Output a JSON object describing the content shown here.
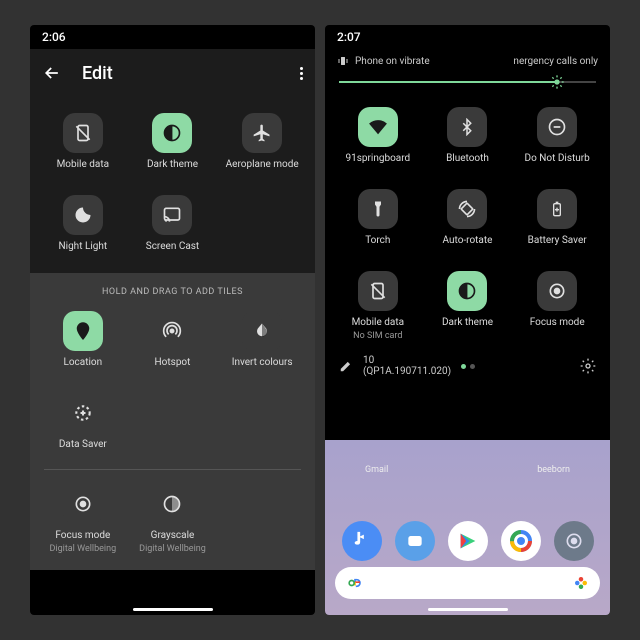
{
  "left": {
    "time": "2:06",
    "edit_title": "Edit",
    "tiles_active": [
      {
        "id": "mobile-data",
        "label": "Mobile data",
        "on": false
      },
      {
        "id": "dark-theme",
        "label": "Dark theme",
        "on": true
      },
      {
        "id": "aeroplane",
        "label": "Aeroplane mode",
        "on": false
      },
      {
        "id": "night-light",
        "label": "Night Light",
        "on": false
      },
      {
        "id": "screen-cast",
        "label": "Screen Cast",
        "on": false
      }
    ],
    "drag_hint": "HOLD AND DRAG TO ADD TILES",
    "tiles_available": [
      {
        "id": "location",
        "label": "Location",
        "on": true
      },
      {
        "id": "hotspot",
        "label": "Hotspot",
        "on": false
      },
      {
        "id": "invert",
        "label": "Invert colours",
        "on": false
      },
      {
        "id": "data-saver",
        "label": "Data Saver",
        "on": false
      }
    ],
    "tiles_wellbeing": [
      {
        "id": "focus-mode",
        "label": "Focus mode",
        "sub": "Digital Wellbeing"
      },
      {
        "id": "grayscale",
        "label": "Grayscale",
        "sub": "Digital Wellbeing"
      }
    ]
  },
  "right": {
    "time": "2:07",
    "vibrate_text": "Phone on vibrate",
    "emergency_text": "nergency calls only",
    "brightness_pct": 85,
    "tiles": [
      {
        "id": "wifi",
        "label": "91springboard",
        "on": true
      },
      {
        "id": "bluetooth",
        "label": "Bluetooth",
        "on": false
      },
      {
        "id": "dnd",
        "label": "Do Not Disturb",
        "on": false
      },
      {
        "id": "torch",
        "label": "Torch",
        "on": false
      },
      {
        "id": "auto-rotate",
        "label": "Auto-rotate",
        "on": false
      },
      {
        "id": "battery-saver",
        "label": "Battery Saver",
        "on": false
      },
      {
        "id": "mobile-data",
        "label": "Mobile data",
        "sub": "No SIM card",
        "on": false
      },
      {
        "id": "dark-theme",
        "label": "Dark theme",
        "on": true
      },
      {
        "id": "focus-mode",
        "label": "Focus mode",
        "on": false
      }
    ],
    "build": "10 (QP1A.190711.020)",
    "home_labels": [
      "Gmail",
      "beeborn"
    ]
  }
}
